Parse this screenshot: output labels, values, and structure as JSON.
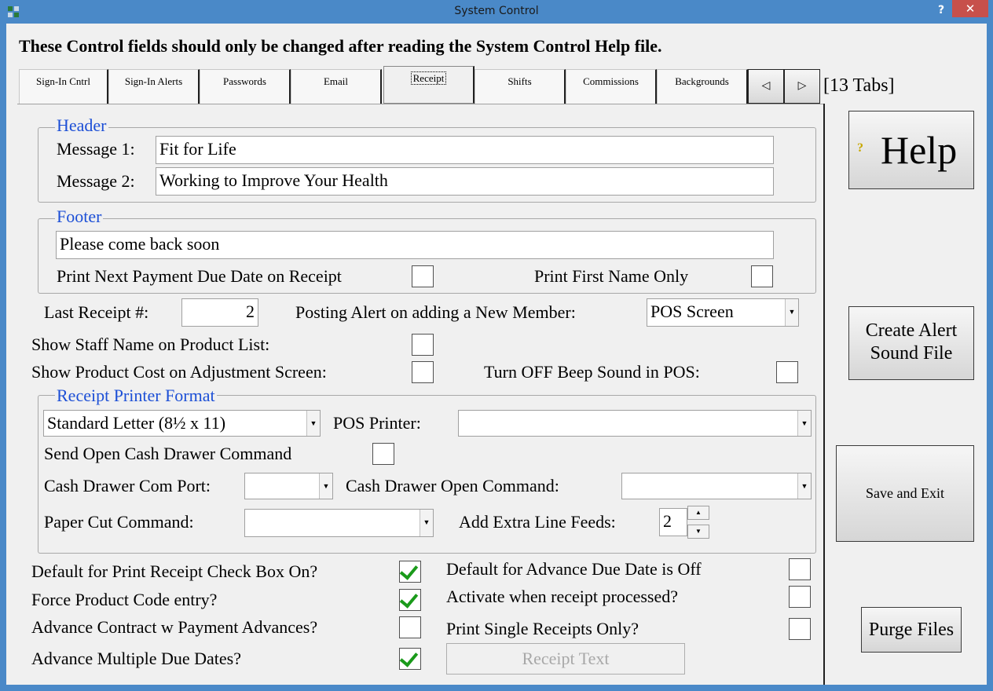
{
  "window": {
    "title": "System Control",
    "help_glyph": "?",
    "close_glyph": "✕"
  },
  "warning": "These Control fields should only be changed after reading the System Control Help file.",
  "tabs": [
    {
      "label": "Sign-In Cntrl"
    },
    {
      "label": "Sign-In Alerts"
    },
    {
      "label": "Passwords"
    },
    {
      "label": "Email"
    },
    {
      "label": "Receipt",
      "active": true
    },
    {
      "label": "Shifts"
    },
    {
      "label": "Commissions"
    },
    {
      "label": "Backgrounds"
    }
  ],
  "tab_nav": {
    "prev": "◁",
    "next": "▷",
    "count": "[13 Tabs]"
  },
  "header": {
    "legend": "Header",
    "message1_label": "Message 1:",
    "message1_value": "Fit for Life",
    "message2_label": "Message 2:",
    "message2_value": "Working to Improve Your Health"
  },
  "footer": {
    "legend": "Footer",
    "value": "Please come back soon",
    "print_next_due_label": "Print Next Payment Due Date on Receipt",
    "print_next_due_checked": false,
    "print_first_name_label": "Print First Name Only",
    "print_first_name_checked": false
  },
  "last_receipt": {
    "label": "Last Receipt #:",
    "value": "2"
  },
  "posting_alert": {
    "label": "Posting Alert on adding a New Member:",
    "value": "POS Screen"
  },
  "show_staff": {
    "label": "Show Staff Name on Product List:",
    "checked": false
  },
  "show_cost": {
    "label": "Show Product Cost on Adjustment Screen:",
    "checked": false
  },
  "beep": {
    "label": "Turn OFF Beep Sound in POS:",
    "checked": false
  },
  "printer_format": {
    "legend": "Receipt Printer Format",
    "format_value": "Standard Letter (8½ x 11)",
    "pos_printer_label": "POS Printer:",
    "pos_printer_value": "",
    "open_drawer_label": "Send Open Cash Drawer Command",
    "open_drawer_checked": false,
    "com_port_label": "Cash Drawer Com Port:",
    "com_port_value": "",
    "open_cmd_label": "Cash Drawer Open Command:",
    "open_cmd_value": "",
    "paper_cut_label": "Paper Cut Command:",
    "paper_cut_value": "",
    "line_feeds_label": "Add Extra Line Feeds:",
    "line_feeds_value": "2"
  },
  "options": {
    "default_print_receipt": {
      "label": "Default for Print Receipt Check Box On?",
      "checked": true
    },
    "force_product_code": {
      "label": "Force Product Code entry?",
      "checked": true
    },
    "advance_contract": {
      "label": "Advance Contract w Payment Advances?",
      "checked": false
    },
    "advance_multiple": {
      "label": "Advance Multiple Due Dates?",
      "checked": true
    },
    "default_advance_off": {
      "label": "Default for Advance Due Date is Off",
      "checked": false
    },
    "activate_receipt": {
      "label": "Activate when receipt processed?",
      "checked": false
    },
    "print_single": {
      "label": "Print Single Receipts Only?",
      "checked": false
    }
  },
  "buttons": {
    "receipt_text": "Receipt Text",
    "help": "Help",
    "help_icon": "?",
    "create_alert_line1": "Create Alert",
    "create_alert_line2": "Sound File",
    "save_exit": "Save and Exit",
    "purge": "Purge Files"
  },
  "colors": {
    "accent": "#1c4fd6",
    "titlebar": "#4a89c8",
    "close": "#c7504b",
    "check": "#1a9a1a"
  }
}
